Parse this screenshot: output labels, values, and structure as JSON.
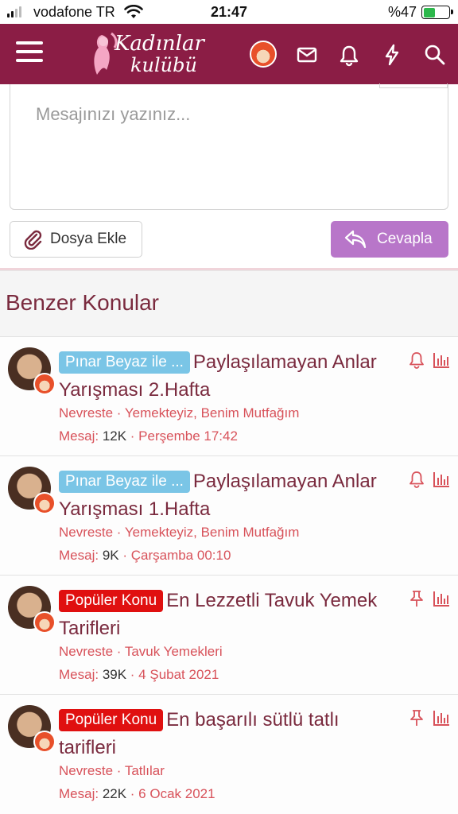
{
  "status_bar": {
    "carrier": "vodafone TR",
    "time": "21:47",
    "battery_percent": "%47",
    "battery_level": 0.47
  },
  "header": {
    "logo_line1": "Kadınlar",
    "logo_line2": "kulübü",
    "icons": [
      "menu-icon",
      "user-avatar",
      "mail-icon",
      "bell-icon",
      "bolt-icon",
      "search-icon"
    ],
    "brand_color": "#8b1d45"
  },
  "editor": {
    "placeholder": "Mesajınızı yazınız...",
    "attach_label": "Dosya Ekle",
    "reply_label": "Cevapla",
    "reply_color": "#b876c9"
  },
  "similar": {
    "heading": "Benzer Konular",
    "threads": [
      {
        "badge": "Pınar Beyaz ile ...",
        "badge_type": "blue",
        "title": "Paylaşılamayan Anlar Yarışması 2.Hafta",
        "author": "Nevreste",
        "forum": "Yemekteyiz, Benim Mutfağım",
        "messages_label": "Mesaj:",
        "messages": "12K",
        "date": "Perşembe 17:42",
        "status_icon": "bell-icon"
      },
      {
        "badge": "Pınar Beyaz ile ...",
        "badge_type": "blue",
        "title": "Paylaşılamayan Anlar Yarışması 1.Hafta",
        "author": "Nevreste",
        "forum": "Yemekteyiz, Benim Mutfağım",
        "messages_label": "Mesaj:",
        "messages": "9K",
        "date": "Çarşamba 00:10",
        "status_icon": "bell-icon"
      },
      {
        "badge": "Popüler Konu",
        "badge_type": "red",
        "title": "En Lezzetli Tavuk Yemek Tarifleri",
        "author": "Nevreste",
        "forum": "Tavuk Yemekleri",
        "messages_label": "Mesaj:",
        "messages": "39K",
        "date": "4 Şubat 2021",
        "status_icon": "pin-icon"
      },
      {
        "badge": "Popüler Konu",
        "badge_type": "red",
        "title": "En başarılı sütlü tatlı tarifleri",
        "author": "Nevreste",
        "forum": "Tatlılar",
        "messages_label": "Mesaj:",
        "messages": "22K",
        "date": "6 Ocak 2021",
        "status_icon": "pin-icon"
      }
    ]
  }
}
